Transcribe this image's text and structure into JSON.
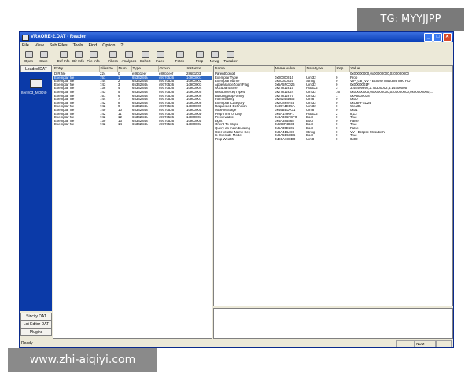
{
  "watermark_top": "TG: MYYJJPP",
  "watermark_bottom": "www.zhi-aiqiyi.com",
  "window": {
    "title": "VRAORE-2.DAT - Reader",
    "buttons": [
      "_",
      "□",
      "✕"
    ]
  },
  "menu": [
    "File",
    "View",
    "Sub Files",
    "Tools",
    "Find",
    "Option",
    "?"
  ],
  "toolbar": [
    {
      "label": "Open",
      "icon": "folder-open-icon"
    },
    {
      "label": "Save",
      "icon": "save-icon"
    },
    {
      "label": "Def Info",
      "icon": "info-icon"
    },
    {
      "label": "Dir Info",
      "icon": "directory-icon"
    },
    {
      "label": "File Info",
      "icon": "file-info-icon"
    },
    {
      "label": "Filters",
      "icon": "filter-icon"
    },
    {
      "label": "Analyses",
      "icon": "analyse-icon"
    },
    {
      "label": "Cohort",
      "icon": "cohort-icon"
    },
    {
      "label": "Index",
      "icon": "index-icon"
    },
    {
      "label": "Fetch",
      "icon": "fetch-icon"
    },
    {
      "label": "Prop",
      "icon": "prop-icon"
    },
    {
      "label": "Newg",
      "icon": "new-icon"
    },
    {
      "label": "Tweaker",
      "icon": "tweaker-icon"
    }
  ],
  "left_panel": {
    "top_tab": "Loaded DAT",
    "item_label": "Item\\03_MOD\\0",
    "bottom_tabs": [
      "Sincity DAT",
      "Lot Editor DAT",
      "Plugins"
    ]
  },
  "file_list": {
    "columns": [
      "Entry",
      "Filesize",
      "Num",
      "Type",
      "Group",
      "Instance"
    ],
    "rows": [
      [
        "DIR file",
        "224",
        "0",
        "e86b1eef",
        "e86b1eef",
        "286b1f03"
      ],
      [
        "Exemplar file",
        "751",
        "1",
        "6534284a",
        "c977c536",
        "1c900001"
      ],
      [
        "Exemplar file",
        "744",
        "2",
        "6534284a",
        "c977c536",
        "1c900002"
      ],
      [
        "Exemplar file",
        "743",
        "3",
        "6534284a",
        "c977c536",
        "1c900003"
      ],
      [
        "Exemplar file",
        "736",
        "4",
        "6534284a",
        "c977c536",
        "1c900004"
      ],
      [
        "Exemplar file",
        "743",
        "5",
        "6534284a",
        "c977c536",
        "1c900005"
      ],
      [
        "Exemplar file",
        "751",
        "6",
        "6534284a",
        "c977c536",
        "1c900006"
      ],
      [
        "Exemplar file",
        "744",
        "7",
        "6534284a",
        "c977c536",
        "1c900007"
      ],
      [
        "Exemplar file",
        "742",
        "8",
        "6534284a",
        "c977c536",
        "1c900008"
      ],
      [
        "Exemplar file",
        "742",
        "9",
        "6534284a",
        "c977c536",
        "1c900009"
      ],
      [
        "Exemplar file",
        "749",
        "10",
        "6534284a",
        "c977c536",
        "1c90000a"
      ],
      [
        "Exemplar file",
        "742",
        "11",
        "6534284a",
        "c977c536",
        "1c90000b"
      ],
      [
        "Exemplar file",
        "742",
        "12",
        "6534284a",
        "c977c536",
        "1c90000c"
      ],
      [
        "Exemplar file",
        "739",
        "13",
        "6534284a",
        "c977c536",
        "1c90000d"
      ],
      [
        "Exemplar file",
        "742",
        "14",
        "6534284a",
        "c977c536",
        "1c90000e"
      ]
    ],
    "selected_index": 1
  },
  "property_list": {
    "columns": [
      "Name",
      "Name value",
      "Data type",
      "Rep",
      "Value"
    ],
    "rows": [
      [
        "ParentCohort",
        "",
        "",
        "",
        "0x00000000,0x00000000,0x00000000"
      ],
      [
        "Exemplar Type",
        "0x00000010",
        "Uint32",
        "0",
        "Prop"
      ],
      [
        "Exemplar Name",
        "0x00000020",
        "String",
        "0",
        "VIP_car_VV - Eclipse Mitsubishi 90 HD"
      ],
      [
        "AppearanceZoomFlag",
        "0x6A5FC026",
        "Uint32",
        "0",
        "0x0000001F"
      ],
      [
        "Occupant Size",
        "0x27812810",
        "Float32",
        "3",
        "3.45499992,2.75300002,6.14400005"
      ],
      [
        "ResourceKeyType4",
        "0x27812824",
        "Uint32",
        "16",
        "0x00000000,0x00000000,0x00000000,0x00000000,..."
      ],
      [
        "BuildingpropFamily",
        "0x27812870",
        "Uint32",
        "1",
        "0xA5000038"
      ],
      [
        "Flammability",
        "0x29244DB5",
        "Uint8",
        "0",
        "0x00"
      ],
      [
        "Exemplar Category",
        "0x2C8F8746",
        "Uint32",
        "0",
        "0xC6FFED24"
      ],
      [
        "Requested Definition",
        "0x49A1E05A",
        "Uint32",
        "0",
        "Wealth"
      ],
      [
        "MaxFireStage",
        "0x49BEDA31",
        "Uint8",
        "0",
        "0x01"
      ],
      [
        "Prop Time of Day",
        "0x4A1496F1",
        "Float32",
        "2",
        "8,13"
      ],
      [
        "Previewable",
        "0x4A366FCF0",
        "Bool",
        "0",
        "True"
      ],
      [
        "Light",
        "0x4A385868",
        "Bool",
        "0",
        "False"
      ],
      [
        "Orient To Slope",
        "0x699F4D33",
        "Bool",
        "0",
        "True"
      ],
      [
        "Query as main building",
        "0x6A35E505",
        "Bool",
        "0",
        "False"
      ],
      [
        "User Visible Name Key",
        "0x8A416A99",
        "String",
        "0",
        "VV - Eclipse Mitsubishi"
      ],
      [
        "Is Override Model",
        "0x8A5E5DB6",
        "Bool",
        "0",
        "True"
      ],
      [
        "Prop Wealth",
        "0xE8A73ED0",
        "Uint8",
        "0",
        "0x02"
      ]
    ]
  },
  "status": {
    "text": "Ready",
    "num": "NUM"
  }
}
